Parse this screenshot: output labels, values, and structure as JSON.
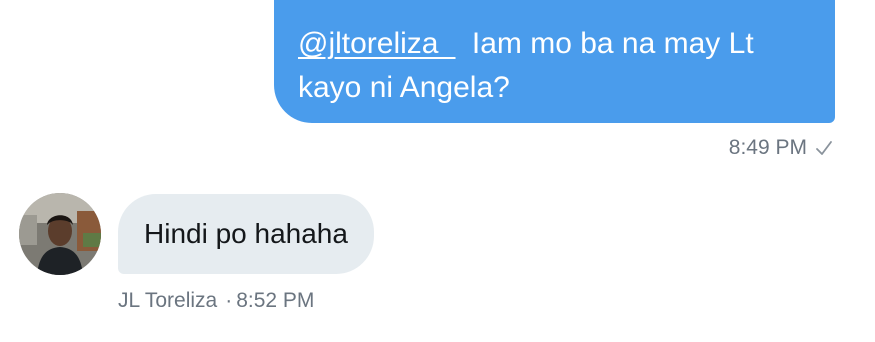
{
  "conversation": {
    "outgoing": {
      "mention": "@jltoreliza_",
      "text_line1": "Iam mo ba na may Lt",
      "text_line2": "kayo ni Angela?",
      "time": "8:49 PM",
      "status_icon": "checkmark-icon"
    },
    "incoming": {
      "text": "Hindi po hahaha",
      "sender": "JL Toreliza",
      "separator": "·",
      "time": "8:52 PM"
    }
  },
  "colors": {
    "outgoing_bubble": "#4a9cec",
    "incoming_bubble": "#e6ecf0",
    "meta_text": "#6b7580"
  }
}
